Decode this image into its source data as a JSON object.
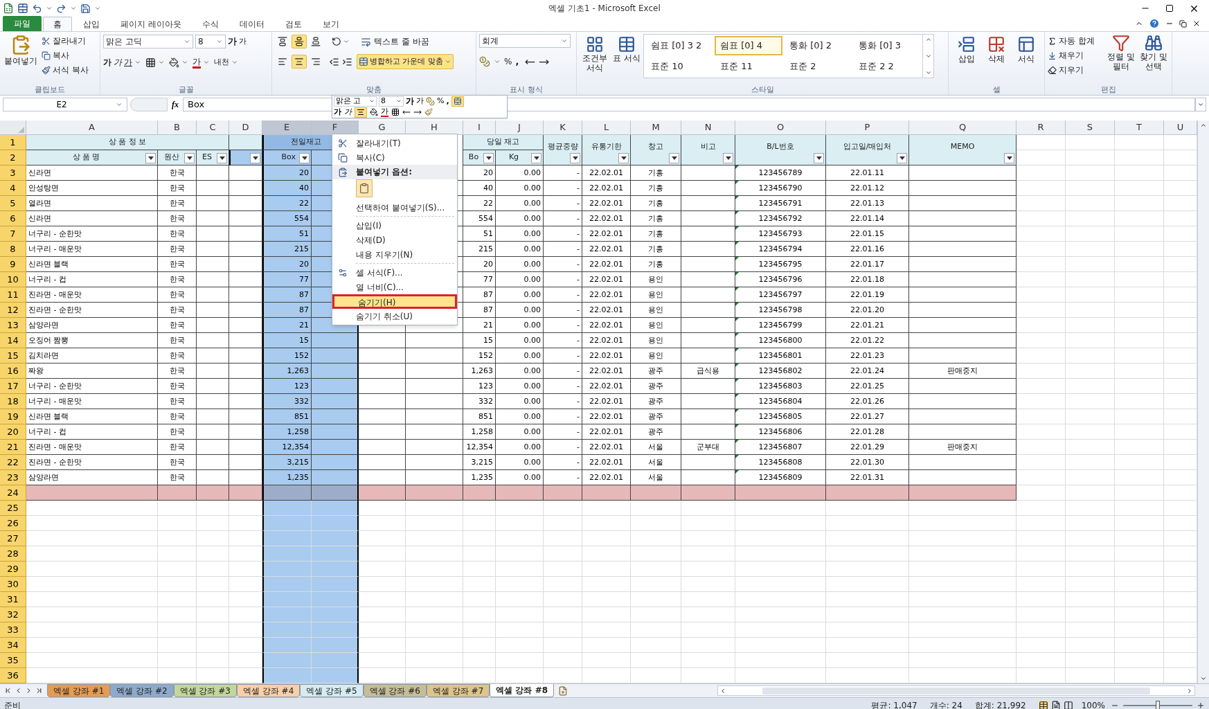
{
  "window": {
    "title": "엑셀 기초1 - Microsoft Excel"
  },
  "ribbon_tabs": [
    {
      "label": "파일",
      "kind": "file",
      "selected": false
    },
    {
      "label": "홈",
      "kind": "tab",
      "selected": true
    },
    {
      "label": "삽입",
      "kind": "tab",
      "selected": false
    },
    {
      "label": "페이지 레이아웃",
      "kind": "tab",
      "selected": false
    },
    {
      "label": "수식",
      "kind": "tab",
      "selected": false
    },
    {
      "label": "데이터",
      "kind": "tab",
      "selected": false
    },
    {
      "label": "검토",
      "kind": "tab",
      "selected": false
    },
    {
      "label": "보기",
      "kind": "tab",
      "selected": false
    }
  ],
  "clipboard": {
    "paste": "붙여넣기",
    "items": [
      "잘라내기",
      "복사",
      "서식 복사"
    ],
    "label": "클립보드"
  },
  "font": {
    "name": "맑은 고딕",
    "size": "8",
    "grow": "가",
    "shrink": "가",
    "bold": "가",
    "italic": "가",
    "underline": "가",
    "text_color": "가",
    "phonetic": "내천",
    "label": "글꼴"
  },
  "alignment": {
    "vertical": [
      {
        "selected": false
      },
      {
        "selected": true
      },
      {
        "selected": false
      }
    ],
    "horizontal": [
      {
        "selected": false
      },
      {
        "selected": true
      },
      {
        "selected": false
      }
    ],
    "wrap_text": "텍스트 줄 바꿈",
    "merge": {
      "label": "병합하고 가운데 맞춤",
      "selected": true
    },
    "label": "맞춤"
  },
  "number": {
    "format": "회계",
    "percent": "%",
    "comma": ",",
    "label": "표시 형식"
  },
  "styles": {
    "conditional": "조건부 서식",
    "table": "표 서식",
    "gallery": [
      {
        "label": "쉼표 [0] 3 2",
        "selected": false
      },
      {
        "label": "쉼표 [0] 4",
        "selected": true
      },
      {
        "label": "통화 [0] 2",
        "selected": false
      },
      {
        "label": "통화 [0] 3",
        "selected": false
      },
      {
        "label": "표준 10",
        "selected": false
      },
      {
        "label": "표준 11",
        "selected": false
      },
      {
        "label": "표준 2",
        "selected": false
      },
      {
        "label": "표준 2 2",
        "selected": false
      }
    ],
    "label": "스타일"
  },
  "cells": {
    "items": [
      "삽입",
      "삭제",
      "서식"
    ],
    "label": "셀"
  },
  "editing": {
    "autosum": "자동 합계",
    "fill": "채우기",
    "clear": "지우기",
    "sort": "정렬 및 필터",
    "find": "찾기 및 선택",
    "label": "편집"
  },
  "formula_bar": {
    "name_box": "E2",
    "function_label": "fx",
    "value": "Box"
  },
  "mini_toolbar": {
    "font": "맑은 고",
    "size": "8",
    "grow": "가",
    "shrink": "가",
    "percent": "%",
    "comma": ",",
    "merge": {
      "selected": true
    },
    "bold": "가",
    "italic": "가",
    "align_center": {
      "selected": true
    },
    "text_color": "가"
  },
  "table": {
    "columns": [
      {
        "letter": "A",
        "selected": false
      },
      {
        "letter": "B",
        "selected": false
      },
      {
        "letter": "C",
        "selected": false
      },
      {
        "letter": "D",
        "selected": false
      },
      {
        "letter": "E",
        "selected": true
      },
      {
        "letter": "F",
        "selected": true
      },
      {
        "letter": "G",
        "selected": false
      },
      {
        "letter": "H",
        "selected": false
      },
      {
        "letter": "I",
        "selected": false
      },
      {
        "letter": "J",
        "selected": false
      },
      {
        "letter": "K",
        "selected": false
      },
      {
        "letter": "L",
        "selected": false
      },
      {
        "letter": "M",
        "selected": false
      },
      {
        "letter": "N",
        "selected": false
      },
      {
        "letter": "O",
        "selected": false
      },
      {
        "letter": "P",
        "selected": false
      },
      {
        "letter": "Q",
        "selected": false
      },
      {
        "letter": "R",
        "selected": false
      },
      {
        "letter": "S",
        "selected": false
      },
      {
        "letter": "T",
        "selected": false
      },
      {
        "letter": "U",
        "selected": false
      }
    ],
    "row_numbers": [
      "1",
      "2",
      "3",
      "4",
      "5",
      "6",
      "7",
      "8",
      "9",
      "10",
      "11",
      "12",
      "13",
      "14",
      "15",
      "16",
      "17",
      "18",
      "19",
      "20",
      "21",
      "22",
      "23",
      "24",
      "25",
      "26",
      "27",
      "28",
      "29",
      "30",
      "31",
      "32",
      "33",
      "34",
      "35",
      "36"
    ],
    "headers": [
      {
        "text": "상 품 정 보",
        "filter": false
      },
      {
        "text": "전일재고",
        "filter": false
      },
      {
        "text": "당일 재고",
        "filter": false
      },
      {
        "text": "평균중량",
        "filter": true
      },
      {
        "text": "유통기한",
        "filter": true
      },
      {
        "text": "창고",
        "filter": true
      },
      {
        "text": "비고",
        "filter": true
      },
      {
        "text": "B/L번호",
        "filter": true
      },
      {
        "text": "입고일/매입처",
        "filter": true
      },
      {
        "text": "MEMO",
        "filter": true
      },
      {
        "text": "상 품 명",
        "filter": true
      },
      {
        "text": "원산",
        "filter": true
      },
      {
        "text": "ES",
        "filter": true
      },
      {
        "filter": true
      },
      {
        "text": "Box",
        "filter": true
      },
      {
        "text": "Bo",
        "filter": true
      },
      {
        "text": "Kg",
        "filter": true
      }
    ],
    "rows": [
      {
        "name": "신라면",
        "origin": "한국",
        "prev_box": "20",
        "today_box": "20",
        "kg": "0.00",
        "avg_weight": "-",
        "expiry": "22.02.01",
        "warehouse": "기흥",
        "bl": "123456789",
        "date": "22.01.11"
      },
      {
        "name": "안성탕면",
        "origin": "한국",
        "prev_box": "40",
        "today_box": "40",
        "kg": "0.00",
        "avg_weight": "-",
        "expiry": "22.02.01",
        "warehouse": "기흥",
        "bl": "123456790",
        "date": "22.01.12"
      },
      {
        "name": "열라면",
        "origin": "한국",
        "prev_box": "22",
        "today_box": "22",
        "kg": "0.00",
        "avg_weight": "-",
        "expiry": "22.02.01",
        "warehouse": "기흥",
        "bl": "123456791",
        "date": "22.01.13"
      },
      {
        "name": "신라면",
        "origin": "한국",
        "prev_box": "554",
        "today_box": "554",
        "kg": "0.00",
        "avg_weight": "-",
        "expiry": "22.02.01",
        "warehouse": "기흥",
        "bl": "123456792",
        "date": "22.01.14"
      },
      {
        "name": "너구리 - 순한맛",
        "origin": "한국",
        "prev_box": "51",
        "today_box": "51",
        "kg": "0.00",
        "avg_weight": "-",
        "expiry": "22.02.01",
        "warehouse": "기흥",
        "bl": "123456793",
        "date": "22.01.15"
      },
      {
        "name": "너구리 - 매운맛",
        "origin": "한국",
        "prev_box": "215",
        "today_box": "215",
        "kg": "0.00",
        "avg_weight": "-",
        "expiry": "22.02.01",
        "warehouse": "기흥",
        "bl": "123456794",
        "date": "22.01.16"
      },
      {
        "name": "신라면 블랙",
        "origin": "한국",
        "prev_box": "20",
        "today_box": "20",
        "kg": "0.00",
        "avg_weight": "-",
        "expiry": "22.02.01",
        "warehouse": "기흥",
        "bl": "123456795",
        "date": "22.01.17"
      },
      {
        "name": "너구리 - 컵",
        "origin": "한국",
        "prev_box": "77",
        "today_box": "77",
        "kg": "0.00",
        "avg_weight": "-",
        "expiry": "22.02.01",
        "warehouse": "용인",
        "bl": "123456796",
        "date": "22.01.18"
      },
      {
        "name": "진라면 - 매운맛",
        "origin": "한국",
        "prev_box": "87",
        "today_box": "87",
        "kg": "0.00",
        "avg_weight": "-",
        "expiry": "22.02.01",
        "warehouse": "용인",
        "bl": "123456797",
        "date": "22.01.19"
      },
      {
        "name": "진라면 - 순한맛",
        "origin": "한국",
        "prev_box": "87",
        "today_box": "87",
        "kg": "0.00",
        "avg_weight": "-",
        "expiry": "22.02.01",
        "warehouse": "용인",
        "bl": "123456798",
        "date": "22.01.20"
      },
      {
        "name": "삼양라면",
        "origin": "한국",
        "prev_box": "21",
        "today_box": "21",
        "kg": "0.00",
        "avg_weight": "-",
        "expiry": "22.02.01",
        "warehouse": "용인",
        "bl": "123456799",
        "date": "22.01.21"
      },
      {
        "name": "오징어 짬뽕",
        "origin": "한국",
        "prev_box": "15",
        "today_box": "15",
        "kg": "0.00",
        "avg_weight": "-",
        "expiry": "22.02.01",
        "warehouse": "용인",
        "bl": "123456800",
        "date": "22.01.22"
      },
      {
        "name": "김치라면",
        "origin": "한국",
        "prev_box": "152",
        "today_box": "152",
        "kg": "0.00",
        "avg_weight": "-",
        "expiry": "22.02.01",
        "warehouse": "용인",
        "bl": "123456801",
        "date": "22.01.23"
      },
      {
        "name": "짜왕",
        "origin": "한국",
        "prev_box": "1,263",
        "today_box": "1,263",
        "kg": "0.00",
        "avg_weight": "-",
        "expiry": "22.02.01",
        "warehouse": "광주",
        "note": "급식용",
        "bl": "123456802",
        "date": "22.01.24",
        "memo": "판매중지"
      },
      {
        "name": "너구리 - 순한맛",
        "origin": "한국",
        "prev_box": "123",
        "today_box": "123",
        "kg": "0.00",
        "avg_weight": "-",
        "expiry": "22.02.01",
        "warehouse": "광주",
        "bl": "123456803",
        "date": "22.01.25"
      },
      {
        "name": "너구리 - 매운맛",
        "origin": "한국",
        "prev_box": "332",
        "today_box": "332",
        "kg": "0.00",
        "avg_weight": "-",
        "expiry": "22.02.01",
        "warehouse": "광주",
        "bl": "123456804",
        "date": "22.01.26"
      },
      {
        "name": "신라면 블랙",
        "origin": "한국",
        "prev_box": "851",
        "today_box": "851",
        "kg": "0.00",
        "avg_weight": "-",
        "expiry": "22.02.01",
        "warehouse": "광주",
        "bl": "123456805",
        "date": "22.01.27"
      },
      {
        "name": "너구리 - 컵",
        "origin": "한국",
        "prev_box": "1,258",
        "today_box": "1,258",
        "kg": "0.00",
        "avg_weight": "-",
        "expiry": "22.02.01",
        "warehouse": "광주",
        "bl": "123456806",
        "date": "22.01.28"
      },
      {
        "name": "진라면 - 매운맛",
        "origin": "한국",
        "prev_box": "12,354",
        "today_box": "12,354",
        "kg": "0.00",
        "avg_weight": "-",
        "expiry": "22.02.01",
        "warehouse": "서울",
        "note": "군부대",
        "bl": "123456807",
        "date": "22.01.29",
        "memo": "판매중지"
      },
      {
        "name": "진라면 - 순한맛",
        "origin": "한국",
        "prev_box": "3,215",
        "today_box": "3,215",
        "kg": "0.00",
        "avg_weight": "-",
        "expiry": "22.02.01",
        "warehouse": "서울",
        "bl": "123456808",
        "date": "22.01.30"
      },
      {
        "name": "삼양라면",
        "origin": "한국",
        "prev_box": "1,235",
        "today_box": "1,235",
        "kg": "0.00",
        "avg_weight": "-",
        "expiry": "22.02.01",
        "warehouse": "서울",
        "bl": "123456809",
        "date": "22.01.31"
      }
    ]
  },
  "context_menu": [
    {
      "kind": "item",
      "label": "잘라내기(T)",
      "selected": false
    },
    {
      "kind": "item",
      "label": "복사(C)",
      "selected": false
    },
    {
      "kind": "header",
      "label": "붙여넣기 옵션:"
    },
    {
      "kind": "paste_options"
    },
    {
      "kind": "item",
      "label": "선택하여 붙여넣기(S)...",
      "selected": false
    },
    {
      "kind": "separator"
    },
    {
      "kind": "item",
      "label": "삽입(I)",
      "selected": false
    },
    {
      "kind": "item",
      "label": "삭제(D)",
      "selected": false
    },
    {
      "kind": "item",
      "label": "내용 지우기(N)",
      "selected": false
    },
    {
      "kind": "separator"
    },
    {
      "kind": "item",
      "label": "셀 서식(F)...",
      "selected": false
    },
    {
      "kind": "item",
      "label": "열 너비(C)...",
      "selected": false
    },
    {
      "kind": "item",
      "label": "숨기기(H)",
      "selected": true
    },
    {
      "kind": "item",
      "label": "숨기기 취소(U)",
      "selected": false
    }
  ],
  "sheet_tabs": [
    {
      "label": "엑셀 강좌 #1",
      "color": "#e59b52",
      "selected": false
    },
    {
      "label": "엑셀 강좌 #2",
      "color": "#8eaacb",
      "selected": false
    },
    {
      "label": "엑셀 강좌 #3",
      "color": "#c3d69b",
      "selected": false
    },
    {
      "label": "엑셀 강좌 #4",
      "color": "#f8cfa9",
      "selected": false
    },
    {
      "label": "엑셀 강좌 #5",
      "color": "#d5ecf2",
      "selected": false
    },
    {
      "label": "엑셀 강좌 #6",
      "color": "#c4bd97",
      "selected": false
    },
    {
      "label": "엑셀 강좌 #7",
      "color": "#dcc48a",
      "selected": false
    },
    {
      "label": "엑셀 강좌 #8",
      "color": "#ffffff",
      "selected": true
    }
  ],
  "status_bar": {
    "mode": "준비",
    "average": "평균: 1,047",
    "count": "개수: 24",
    "sum": "합계: 21,992",
    "zoom": "100%",
    "zoom_slider": {
      "level": 0.5
    }
  }
}
